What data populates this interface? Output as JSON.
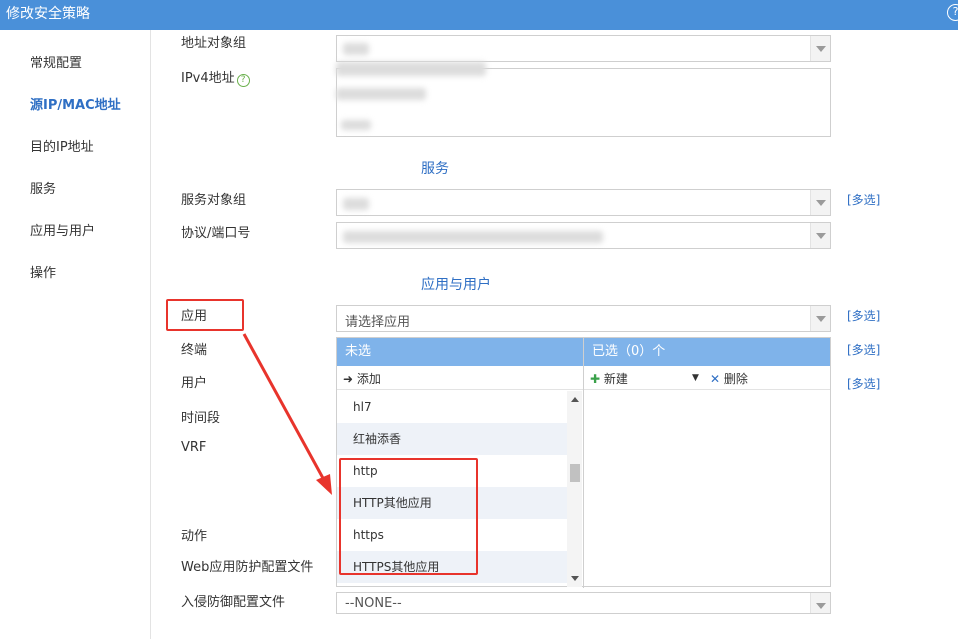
{
  "window": {
    "title": "修改安全策略",
    "help_glyph": "?"
  },
  "sidebar": {
    "items": [
      {
        "label": "常规配置",
        "active": false
      },
      {
        "label": "源IP/MAC地址",
        "active": true
      },
      {
        "label": "目的IP地址",
        "active": false
      },
      {
        "label": "服务",
        "active": false
      },
      {
        "label": "应用与用户",
        "active": false
      },
      {
        "label": "操作",
        "active": false
      }
    ]
  },
  "form": {
    "addr_group_label": "地址对象组",
    "ipv4_label": "IPv4地址",
    "service_section": "服务",
    "service_group_label": "服务对象组",
    "protocol_port_label": "协议/端口号",
    "app_user_section": "应用与用户",
    "app_label": "应用",
    "app_placeholder": "请选择应用",
    "terminal_label": "终端",
    "user_label": "用户",
    "time_label": "时间段",
    "vrf_label": "VRF",
    "action_label": "动作",
    "waf_label": "Web应用防护配置文件",
    "ips_label": "入侵防御配置文件",
    "ips_value": "--NONE--",
    "multi_select": "[多选]"
  },
  "transfer": {
    "unselected_header": "未选",
    "selected_header": "已选（0）个",
    "add_label": "添加",
    "new_label": "新建",
    "delete_label": "删除",
    "items": [
      "hl7",
      "红袖添香",
      "http",
      "HTTP其他应用",
      "https",
      "HTTPS其他应用"
    ]
  },
  "colors": {
    "titlebar": "#4a90d9",
    "accent": "#2f6fc4",
    "transfer_header": "#7fb3ea",
    "annotation_red": "#e8342c"
  }
}
